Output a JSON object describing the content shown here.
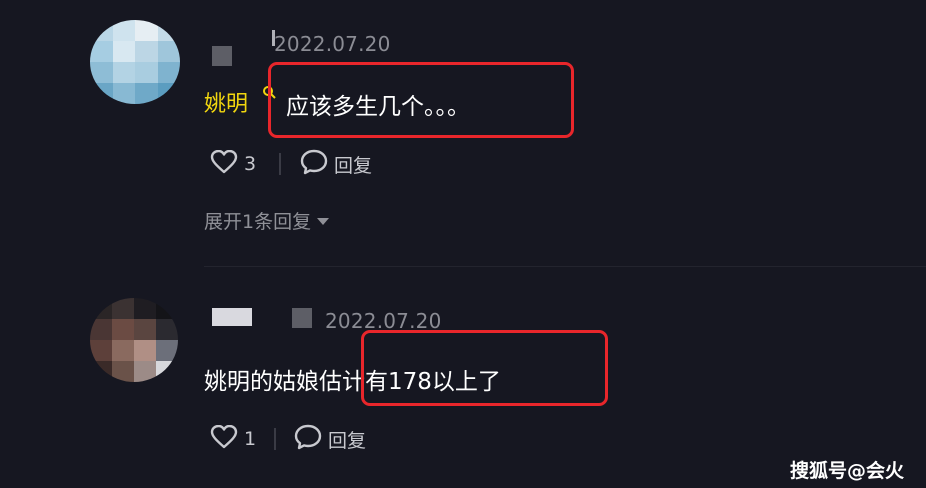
{
  "comments": [
    {
      "date": "2022.07.20",
      "username": "姚明",
      "text": "应该多生几个。。。",
      "likes": "3",
      "reply_label": "回复",
      "expand_label": "展开1条回复"
    },
    {
      "date": "2022.07.20",
      "text": "姚明的姑娘估计有178以上了",
      "likes": "1",
      "reply_label": "回复"
    }
  ],
  "watermark": "搜狐号@会火",
  "colors": {
    "background": "#161721",
    "highlight_box": "#e8262b",
    "username": "#f1d60f"
  },
  "icons": [
    "heart-icon",
    "comment-bubble-icon",
    "search-icon",
    "chevron-down-icon"
  ]
}
